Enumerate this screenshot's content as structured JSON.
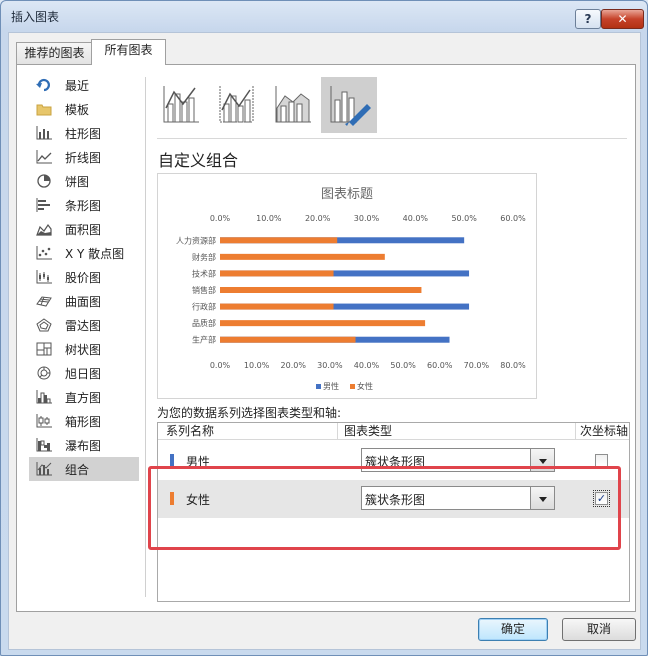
{
  "window": {
    "title": "插入图表",
    "help_label": "?",
    "close_label": "✕"
  },
  "tabs": [
    {
      "label": "推荐的图表",
      "selected": false
    },
    {
      "label": "所有图表",
      "selected": true
    }
  ],
  "sidebar": {
    "items": [
      {
        "label": "最近",
        "icon": "recent-icon"
      },
      {
        "label": "模板",
        "icon": "folder-icon"
      },
      {
        "label": "柱形图",
        "icon": "column-chart-icon"
      },
      {
        "label": "折线图",
        "icon": "line-chart-icon"
      },
      {
        "label": "饼图",
        "icon": "pie-chart-icon"
      },
      {
        "label": "条形图",
        "icon": "bar-chart-icon"
      },
      {
        "label": "面积图",
        "icon": "area-chart-icon"
      },
      {
        "label": "X Y 散点图",
        "icon": "scatter-chart-icon"
      },
      {
        "label": "股价图",
        "icon": "stock-chart-icon"
      },
      {
        "label": "曲面图",
        "icon": "surface-chart-icon"
      },
      {
        "label": "雷达图",
        "icon": "radar-chart-icon"
      },
      {
        "label": "树状图",
        "icon": "treemap-chart-icon"
      },
      {
        "label": "旭日图",
        "icon": "sunburst-chart-icon"
      },
      {
        "label": "直方图",
        "icon": "histogram-chart-icon"
      },
      {
        "label": "箱形图",
        "icon": "box-whisker-chart-icon"
      },
      {
        "label": "瀑布图",
        "icon": "waterfall-chart-icon"
      },
      {
        "label": "组合",
        "icon": "combo-chart-icon",
        "selected": true
      }
    ]
  },
  "subtypes": {
    "icons": [
      "combo-column-line-icon",
      "combo-column-line-secondary-icon",
      "combo-stacked-area-column-icon",
      "custom-combo-icon"
    ],
    "selected_index": 3,
    "heading": "自定义组合"
  },
  "chart_data": {
    "type": "bar",
    "title": "图表标题",
    "categories": [
      "人力资源部",
      "财务部",
      "技术部",
      "销售部",
      "行政部",
      "品质部",
      "生产部"
    ],
    "series": [
      {
        "name": "男性",
        "color": "#4472c4",
        "values": [
          50,
          0,
          51,
          0,
          51,
          0,
          47
        ],
        "axis": "primary",
        "top_ticks": [
          "0.0%",
          "10.0%",
          "20.0%",
          "30.0%",
          "40.0%",
          "50.0%",
          "60.0%"
        ],
        "xlim": [
          0,
          60
        ]
      },
      {
        "name": "女性",
        "color": "#ed7d31",
        "values": [
          32,
          45,
          31,
          55,
          31,
          56,
          37
        ],
        "axis": "secondary",
        "bottom_ticks": [
          "0.0%",
          "10.0%",
          "20.0%",
          "30.0%",
          "40.0%",
          "50.0%",
          "60.0%",
          "70.0%",
          "80.0%"
        ],
        "xlim": [
          0,
          80
        ]
      }
    ],
    "legend_position": "bottom",
    "grid": false
  },
  "series_section": {
    "prompt": "为您的数据系列选择图表类型和轴:",
    "col_name": "系列名称",
    "col_type": "图表类型",
    "col_axis": "次坐标轴",
    "rows": [
      {
        "name": "男性",
        "color": "#4472c4",
        "type": "簇状条形图",
        "secondary_axis": false
      },
      {
        "name": "女性",
        "color": "#ed7d31",
        "type": "簇状条形图",
        "secondary_axis": true
      }
    ]
  },
  "footer": {
    "ok_label": "确定",
    "cancel_label": "取消"
  }
}
